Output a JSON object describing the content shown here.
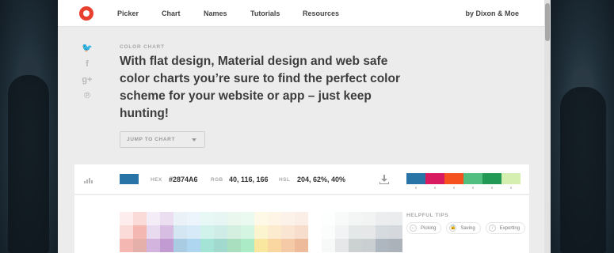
{
  "nav": {
    "items": [
      "Picker",
      "Chart",
      "Names",
      "Tutorials",
      "Resources"
    ],
    "byline": "by Dixon & Moe"
  },
  "social": {
    "icons": [
      "twitter-icon",
      "facebook-icon",
      "google-plus-icon",
      "pinterest-icon"
    ],
    "glyphs": [
      "🐦",
      "f",
      "g+",
      "℗"
    ]
  },
  "hero": {
    "eyebrow": "COLOR CHART",
    "headline": "With flat design, Material design and web safe color charts you’re sure to find the perfect color scheme for your website or app – just keep hunting!",
    "jump_label": "JUMP TO CHART"
  },
  "color_info": {
    "swatch_color": "#2874A6",
    "hex_label": "HEX",
    "hex_value": "#2874A6",
    "rgb_label": "RGB",
    "rgb_value": "40, 116, 166",
    "hsl_label": "HSL",
    "hsl_value": "204, 62%, 40%",
    "palette": [
      "#2874A6",
      "#D81B60",
      "#F4511E",
      "#52BE80",
      "#229954",
      "#D4EFAF"
    ]
  },
  "tips": {
    "title": "HELPFUL TIPS",
    "items": [
      "Picking",
      "Saving",
      "Exporting"
    ],
    "icons": [
      "←",
      "🔒",
      "↓"
    ]
  },
  "chart_grid": {
    "rows": [
      [
        "#FDEDEC",
        "#FADBD8",
        "#F4ECF7",
        "#EBDEF0",
        "#EAF2F8",
        "#EBF5FB",
        "#E8F8F5",
        "#E8F6F3",
        "#E9F7EF",
        "#EAFAF1",
        "#FEF9E7",
        "#FEF5E7",
        "#FDF2E9",
        "#FBEEE6",
        "#FDFEFE",
        "#F8F9F9",
        "#F4F6F6",
        "#F2F4F4",
        "#EBEDEF",
        "#EAECEE"
      ],
      [
        "#FADBD8",
        "#F5B7B1",
        "#E8DAEF",
        "#D7BDE2",
        "#D4E6F1",
        "#D6EAF8",
        "#D1F2EB",
        "#D0ECE7",
        "#D4EFDF",
        "#D5F5E3",
        "#FCF3CF",
        "#FDEBD0",
        "#FAE5D3",
        "#F6DDCC",
        "#FBFCFC",
        "#F2F3F4",
        "#E5E8E8",
        "#E5E7E9",
        "#D6DBDF",
        "#D5D8DC"
      ],
      [
        "#F5B7B1",
        "#E6B0AA",
        "#D2B4DE",
        "#C39BD3",
        "#A9CCE3",
        "#AED6F1",
        "#A3E4D7",
        "#A2D9CE",
        "#A9DFBF",
        "#ABEBC6",
        "#F9E79F",
        "#FAD7A0",
        "#F5CBA7",
        "#EDBB99",
        "#F7F9F9",
        "#E5E7E9",
        "#CCD1D1",
        "#CACFD2",
        "#AEB6BF",
        "#ABB2B9"
      ]
    ]
  }
}
